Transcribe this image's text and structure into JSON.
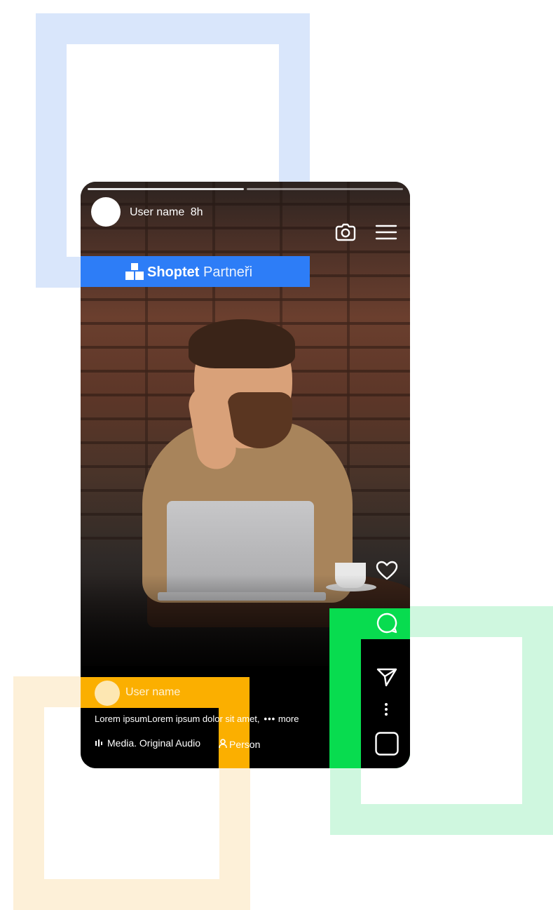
{
  "story": {
    "top_username": "User name",
    "time_ago": "8h",
    "bottom_username": "User name",
    "caption": "Lorem ipsumLorem ipsum dolor sit amet,",
    "more_dots": "•••",
    "more_label": "more",
    "audio_label": "Media. Original Audio",
    "person_label": "Person"
  },
  "brand": {
    "name_bold": "Shoptet",
    "name_light": "Partneři"
  },
  "colors": {
    "blue": "#2d7df7",
    "green": "#08dc4f",
    "yellow": "#fbaf00"
  },
  "icons": [
    "camera-icon",
    "menu-icon",
    "heart-icon",
    "comment-icon",
    "send-icon",
    "more-vertical-icon",
    "square-icon",
    "audio-bars-icon",
    "person-icon"
  ]
}
